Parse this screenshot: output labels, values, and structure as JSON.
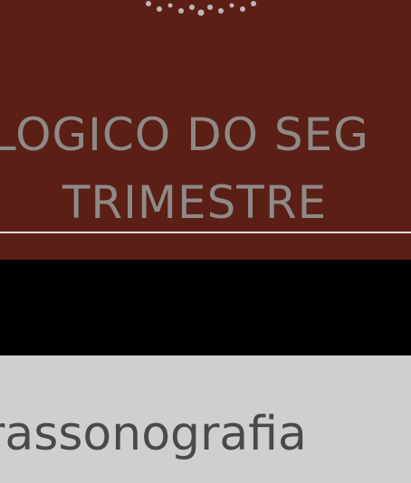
{
  "banner": {
    "title_line1": "LOGICO DO SEG",
    "title_line2": "TRIMESTRE",
    "background_color": "#5b1f16",
    "text_color": "#8f8a86",
    "logo_icon": "dotted-arc-logo"
  },
  "caption": {
    "text": "rassonografia"
  }
}
